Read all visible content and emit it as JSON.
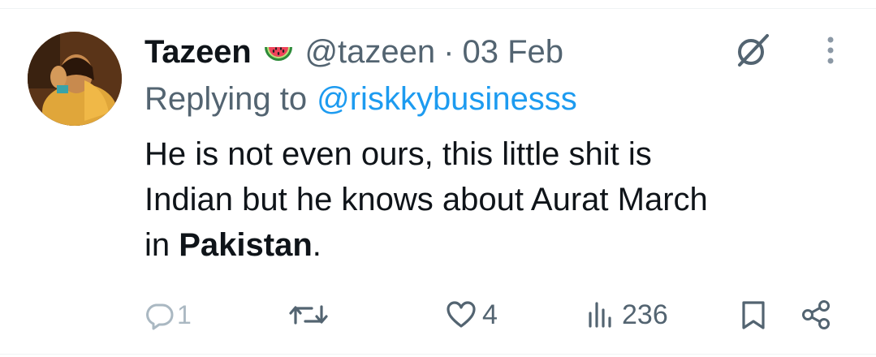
{
  "tweet": {
    "display_name": "Tazeen",
    "emoji": "watermelon-emoji",
    "handle": "@tazeen",
    "separator": "·",
    "date": "03 Feb",
    "replying_to_label": "Replying to",
    "replying_to_handle": "@riskkybusinesss",
    "text_line1": "He is not even ours, this little shit is",
    "text_line2": "Indian but he knows about Aurat March",
    "text_line3_start": "in ",
    "text_line3_bold": "Pakistan",
    "text_line3_end": "."
  },
  "actions": {
    "reply_count": "1",
    "retweet_count": "",
    "like_count": "4",
    "views_count": "236"
  },
  "colors": {
    "text_primary": "#0f1419",
    "text_secondary": "#536471",
    "accent": "#1d9bf0"
  },
  "icons": [
    "grok-icon",
    "more-icon",
    "reply-icon",
    "retweet-icon",
    "like-icon",
    "views-icon",
    "bookmark-icon",
    "share-icon"
  ]
}
